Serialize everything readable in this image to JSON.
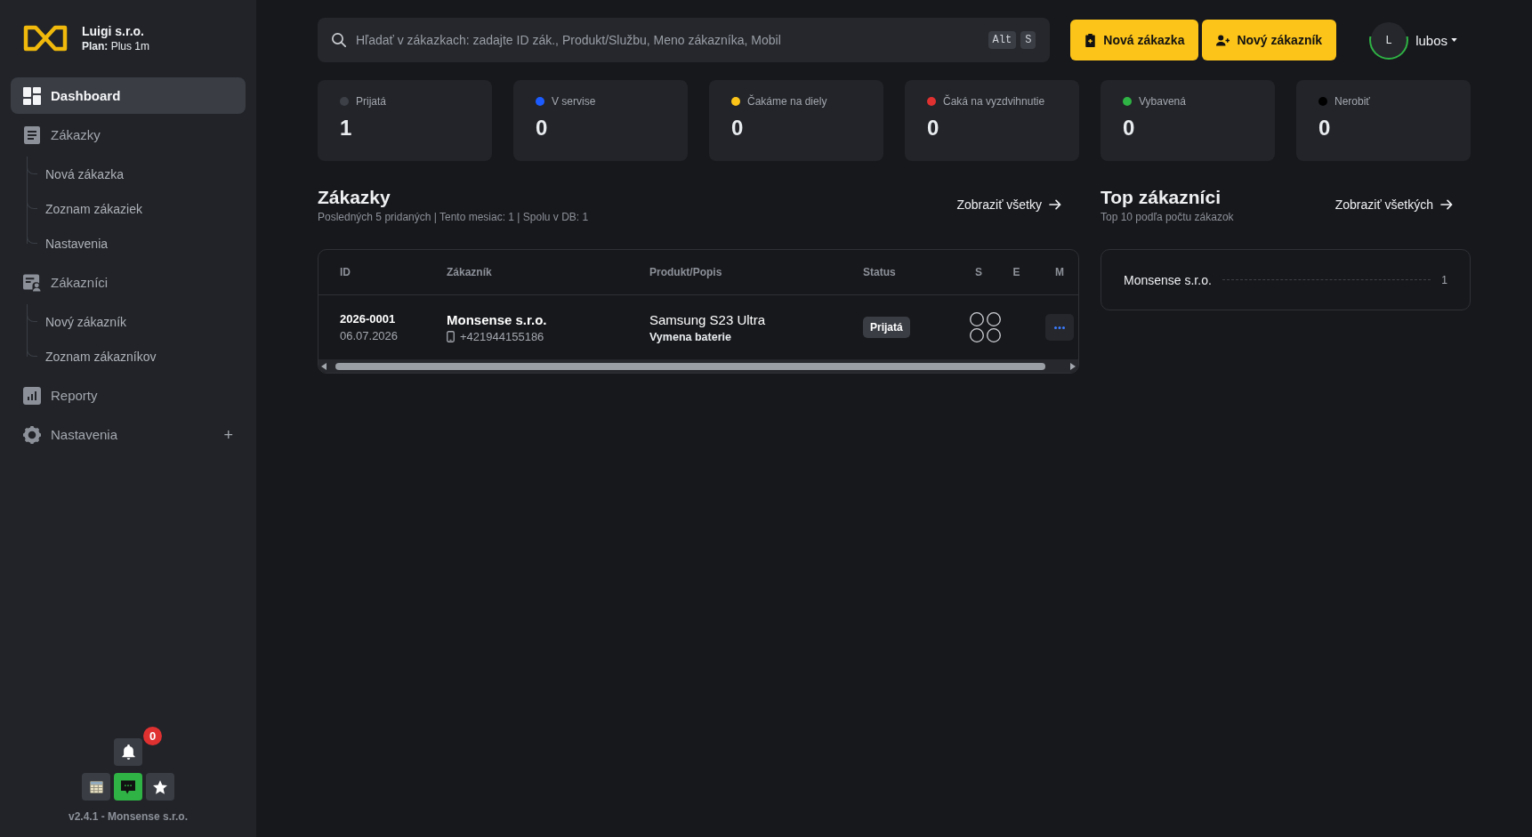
{
  "sidebar": {
    "brand": {
      "name": "Luigi s.r.o.",
      "plan": "**Plan:** Plus 1m"
    },
    "nav": [
      {
        "label": "Dashboard",
        "selected": true
      },
      {
        "label": "Zákazky",
        "selected": false,
        "children": [
          {
            "label": "Nová zákazka",
            "selected": false
          },
          {
            "label": "Zoznam zákaziek",
            "selected": false
          },
          {
            "label": "Nastavenia",
            "selected": false
          }
        ]
      },
      {
        "label": "Zákazníci",
        "selected": false,
        "children": [
          {
            "label": "Nový zákazník",
            "selected": false
          },
          {
            "label": "Zoznam zákazníkov",
            "selected": false
          }
        ]
      },
      {
        "label": "Reporty",
        "selected": false
      },
      {
        "label": "Nastavenia",
        "selected": false,
        "toggle": "+"
      }
    ],
    "footer": {
      "notifications": {
        "count": "0"
      },
      "buttons": [
        {
          "kind": "spreadsheet",
          "on": false
        },
        {
          "kind": "chat",
          "on": true
        },
        {
          "kind": "star",
          "on": false
        }
      ],
      "version": "v2.4.1 - Monsense s.r.o."
    }
  },
  "topbar": {
    "search": {
      "placeholder": "Hľadať v zákazkach: zadajte ID zák., Produkt/Službu, Meno zákazníka, Mobil",
      "shortcut": [
        "Alt",
        "S"
      ]
    },
    "actions": [
      {
        "label": "Nová zákazka"
      },
      {
        "label": "Nový zákazník"
      }
    ],
    "user": {
      "initial": "L",
      "name": "lubos"
    }
  },
  "stats": [
    {
      "label": "Prijatá",
      "value": "1",
      "color": "#3d4047"
    },
    {
      "label": "V servise",
      "value": "0",
      "color": "#1c5cff"
    },
    {
      "label": "Čakáme na diely",
      "value": "0",
      "color": "#fcc419"
    },
    {
      "label": "Čaká na vyzdvihnutie",
      "value": "0",
      "color": "#e03131"
    },
    {
      "label": "Vybavená",
      "value": "0",
      "color": "#2fb344"
    },
    {
      "label": "Nerobiť",
      "value": "0",
      "color": "#000000"
    }
  ],
  "orders": {
    "title": "Zákazky",
    "subtitle": "Posledných 5 pridaných | Tento mesiac: 1 | Spolu v DB: 1",
    "link": "Zobraziť všetky",
    "table": {
      "columns": [
        "ID",
        "Zákazník",
        "Produkt/Popis",
        "Status",
        "S",
        "E",
        "M"
      ],
      "rows": [
        {
          "id": "2026-0001",
          "date": "06.07.2026",
          "customer": "Monsense s.r.o.",
          "phone": "+421944155186",
          "product": "Samsung S23 Ultra",
          "description": "Vymena baterie",
          "status": "Prijatá",
          "flags": [
            {
              "checked": false
            },
            {
              "checked": false
            },
            {
              "checked": false
            },
            {
              "checked": false
            }
          ]
        }
      ]
    }
  },
  "top_customers": {
    "title": "Top zákazníci",
    "subtitle": "Top 10 podľa počtu zákazok",
    "link": "Zobraziť všetkých",
    "items": [
      {
        "name": "Monsense s.r.o.",
        "count": "1"
      }
    ]
  }
}
